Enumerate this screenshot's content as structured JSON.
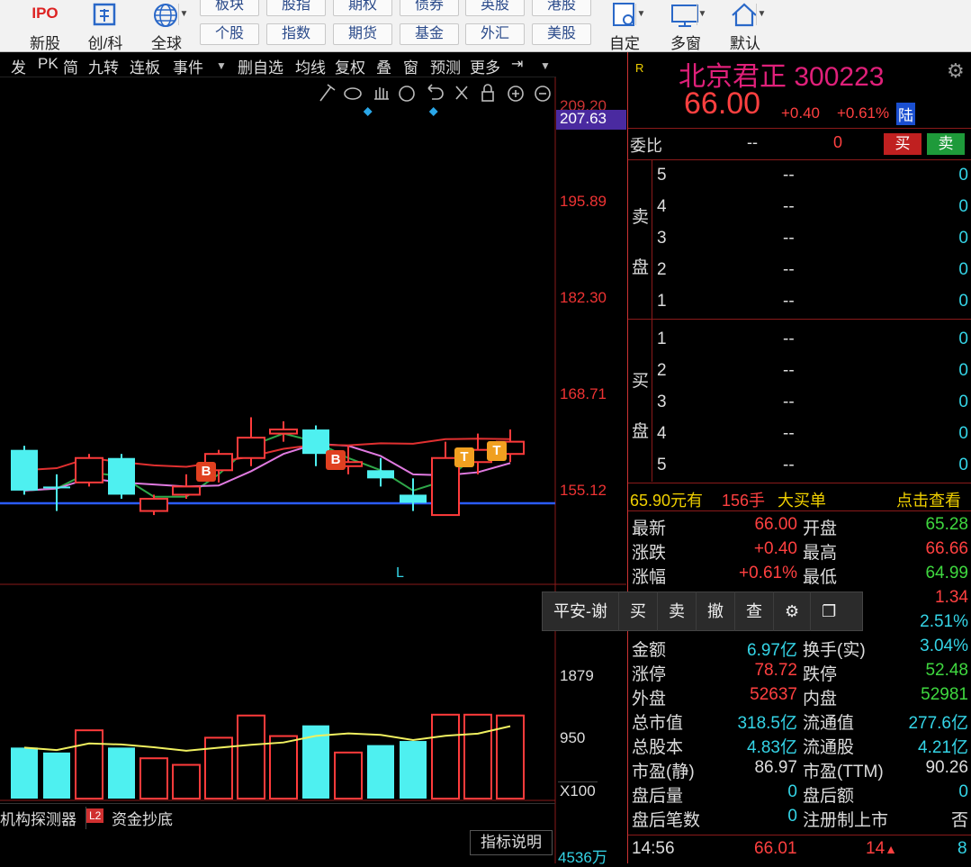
{
  "toolbar": {
    "big": [
      {
        "label": "新股",
        "icon": "ipo-icon"
      },
      {
        "label": "创/科",
        "icon": "chuang-icon"
      },
      {
        "label": "全球",
        "icon": "globe-icon"
      },
      {
        "label": "自定",
        "icon": "custom-icon"
      },
      {
        "label": "多窗",
        "icon": "multiwindow-icon"
      },
      {
        "label": "默认",
        "icon": "home-icon"
      }
    ],
    "ipo_text": "IPO",
    "row1": [
      "板块",
      "股指",
      "期权",
      "债券",
      "英股",
      "港股"
    ],
    "row2": [
      "个股",
      "指数",
      "期货",
      "基金",
      "外汇",
      "美股"
    ]
  },
  "chart_toolbar": [
    "发",
    "PK",
    "简",
    "九转",
    "连板",
    "事件",
    "删自选",
    "均线",
    "复权",
    "叠",
    "窗",
    "预测",
    "更多"
  ],
  "price_axis": [
    "209.20",
    "207.63",
    "195.89",
    "182.30",
    "168.71",
    "155.12"
  ],
  "volume_axis": [
    "1879",
    "950",
    "X100"
  ],
  "markers": {
    "b": "B",
    "t": "T",
    "l": "L"
  },
  "bottom_tabs": {
    "tab1": "机构探测器",
    "badge": "L2",
    "tab2": "资金抄底",
    "help": "指标说明",
    "vol": "4536万"
  },
  "quote": {
    "r_icon": "R",
    "name": "北京君正",
    "code": "300223",
    "price": "66.00",
    "change": "+0.40",
    "pct": "+0.61%",
    "lu": "陆",
    "weibi_label": "委比",
    "weibi_val": "--",
    "weibi_num": "0",
    "buy_btn": "买",
    "sell_btn": "卖",
    "sell_label_1": "卖",
    "sell_label_2": "盘",
    "buy_label_1": "买",
    "buy_label_2": "盘",
    "sell_levels": [
      [
        "5",
        "--",
        "0"
      ],
      [
        "4",
        "--",
        "0"
      ],
      [
        "3",
        "--",
        "0"
      ],
      [
        "2",
        "--",
        "0"
      ],
      [
        "1",
        "--",
        "0"
      ]
    ],
    "buy_levels": [
      [
        "1",
        "--",
        "0"
      ],
      [
        "2",
        "--",
        "0"
      ],
      [
        "3",
        "--",
        "0"
      ],
      [
        "4",
        "--",
        "0"
      ],
      [
        "5",
        "--",
        "0"
      ]
    ],
    "bigorder": {
      "amount": "65.90元有",
      "hands": "156手",
      "label": "大买单",
      "link": "点击查看"
    },
    "stats": [
      [
        "最新",
        "66.00",
        "red",
        "开盘",
        "65.28",
        "green"
      ],
      [
        "涨跌",
        "+0.40",
        "red",
        "最高",
        "66.66",
        "red"
      ],
      [
        "涨幅",
        "+0.61%",
        "red",
        "最低",
        "64.99",
        "green"
      ],
      [
        "",
        "",
        "",
        "",
        "1.34",
        "red"
      ],
      [
        "",
        "",
        "",
        "",
        "2.51%",
        "cyan"
      ],
      [
        "金额",
        "6.97亿",
        "cyan",
        "换手(实)",
        "3.04%",
        "cyan"
      ],
      [
        "涨停",
        "78.72",
        "red",
        "跌停",
        "52.48",
        "green"
      ],
      [
        "外盘",
        "52637",
        "red",
        "内盘",
        "52981",
        "green"
      ],
      [
        "总市值",
        "318.5亿",
        "cyan",
        "流通值",
        "277.6亿",
        "cyan"
      ],
      [
        "总股本",
        "4.83亿",
        "cyan",
        "流通股",
        "4.21亿",
        "cyan"
      ],
      [
        "市盈(静)",
        "86.97",
        "white",
        "市盈(TTM)",
        "90.26",
        "white"
      ],
      [
        "盘后量",
        "0",
        "cyan",
        "盘后额",
        "0",
        "cyan"
      ],
      [
        "盘后笔数",
        "0",
        "cyan",
        "注册制上市",
        "否",
        "white"
      ]
    ],
    "tick": {
      "time": "14:56",
      "price": "66.01",
      "vol": "14",
      "n": "8"
    }
  },
  "trade_popup": {
    "account": "平安-谢",
    "buy": "买",
    "sell": "卖",
    "cancel": "撤",
    "query": "查"
  },
  "chart_data": {
    "type": "candlestick",
    "ylim": [
      150,
      210
    ],
    "candles": [
      {
        "o": 166.5,
        "c": 161.5,
        "h": 167,
        "l": 161,
        "up": false
      },
      {
        "o": 162,
        "c": 162,
        "h": 163.5,
        "l": 159,
        "up": false
      },
      {
        "o": 162.5,
        "c": 165.5,
        "h": 166,
        "l": 162,
        "up": true
      },
      {
        "o": 165.5,
        "c": 161,
        "h": 166,
        "l": 160.5,
        "up": false
      },
      {
        "o": 159,
        "c": 160.5,
        "h": 161,
        "l": 158.5,
        "up": true
      },
      {
        "o": 162,
        "c": 161,
        "h": 163.5,
        "l": 160.5,
        "up": true
      },
      {
        "o": 164,
        "c": 166,
        "h": 166.5,
        "l": 162.5,
        "up": true
      },
      {
        "o": 165.5,
        "c": 168,
        "h": 170.5,
        "l": 164.5,
        "up": true
      },
      {
        "o": 168.5,
        "c": 169,
        "h": 170,
        "l": 167.5,
        "up": true
      },
      {
        "o": 169,
        "c": 166,
        "h": 169.5,
        "l": 164.5,
        "up": false
      },
      {
        "o": 164.5,
        "c": 165,
        "h": 167,
        "l": 163.5,
        "up": true
      },
      {
        "o": 164,
        "c": 163,
        "h": 165.5,
        "l": 162,
        "up": false
      },
      {
        "o": 161,
        "c": 160,
        "h": 163,
        "l": 159,
        "up": false
      },
      {
        "o": 158.5,
        "c": 165.5,
        "h": 167.5,
        "l": 158.5,
        "up": true
      },
      {
        "o": 165,
        "c": 166.5,
        "h": 168.5,
        "l": 163.5,
        "up": true
      },
      {
        "o": 166,
        "c": 167.5,
        "h": 169,
        "l": 165,
        "up": true
      }
    ],
    "volume": [
      620,
      560,
      830,
      620,
      490,
      410,
      740,
      1010,
      760,
      890,
      560,
      650,
      700,
      1020,
      1020,
      1010
    ],
    "volume_ylim": [
      0,
      2200
    ]
  }
}
